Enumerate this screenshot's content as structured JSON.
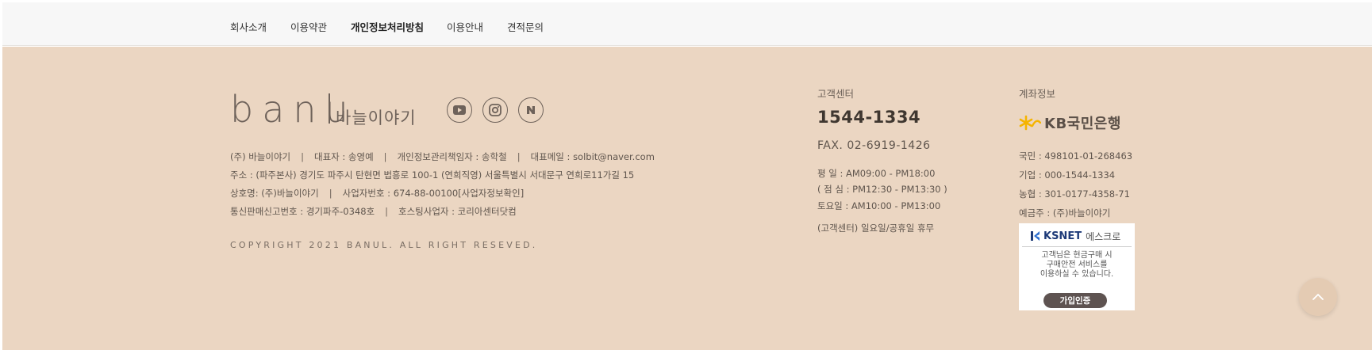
{
  "nav": {
    "items": [
      {
        "label": "회사소개"
      },
      {
        "label": "이용약관"
      },
      {
        "label": "개인정보처리방침"
      },
      {
        "label": "이용안내"
      },
      {
        "label": "견적문의"
      }
    ]
  },
  "brand": {
    "logo_main": "banu",
    "logo_sub": "바늘이야기"
  },
  "social": {
    "icons": [
      "youtube-icon",
      "instagram-icon",
      "naver-icon"
    ]
  },
  "company": {
    "line1": {
      "name": "(주) 바늘이야기",
      "ceo": "대표자 : 송영예",
      "privacy": "개인정보관리책임자 : 송학철",
      "email": "대표메일 : solbit@naver.com"
    },
    "address": "주소 : (파주본사) 경기도 파주시 탄현면 법흥로 100-1 (연희직영) 서울특별시 서대문구 연희로11가길 15",
    "line3": {
      "trade_name": "상호명: (주)바늘이야기",
      "biz_no": "사업자번호 : 674-88-00100[사업자정보확인]"
    },
    "line4": {
      "ecommerce": "통신판매신고번호 : 경기파주-0348호",
      "hosting": "호스팅사업자 : 코리아센터닷컴"
    },
    "copyright": "COPYRIGHT 2021 BANUL. ALL RIGHT RESEVED."
  },
  "customer_center": {
    "title": "고객센터",
    "phone": "1544-1334",
    "fax": "FAX. 02-6919-1426",
    "weekday": "평    일 : AM09:00 - PM18:00",
    "lunch": "( 점 심 : PM12:30 - PM13:30 )",
    "saturday": "토요일 : AM10:00 - PM13:00",
    "holiday": "(고객센터) 일요일/공휴일 휴무"
  },
  "account": {
    "title": "계좌정보",
    "bank_logo_text": "KB국민은행",
    "kookmin": "국민 : 498101-01-268463",
    "ibk": "기업 : 000-1544-1334",
    "nh": "농협 : 301-0177-4358-71",
    "holder": "예금주 : (주)바늘이야기"
  },
  "escrow": {
    "brand": "KSNET",
    "label": "에스크로",
    "text1": "고객님은 현금구매 시",
    "text2": "구매안전 서비스를",
    "text3": "이용하실 수 있습니다.",
    "button": "가입인증"
  },
  "colors": {
    "footer_bg": "#ebd6c2",
    "nav_bg": "#f7f7f7",
    "kb_yellow": "#f5b400",
    "ksnet_blue": "#1d3a78"
  }
}
